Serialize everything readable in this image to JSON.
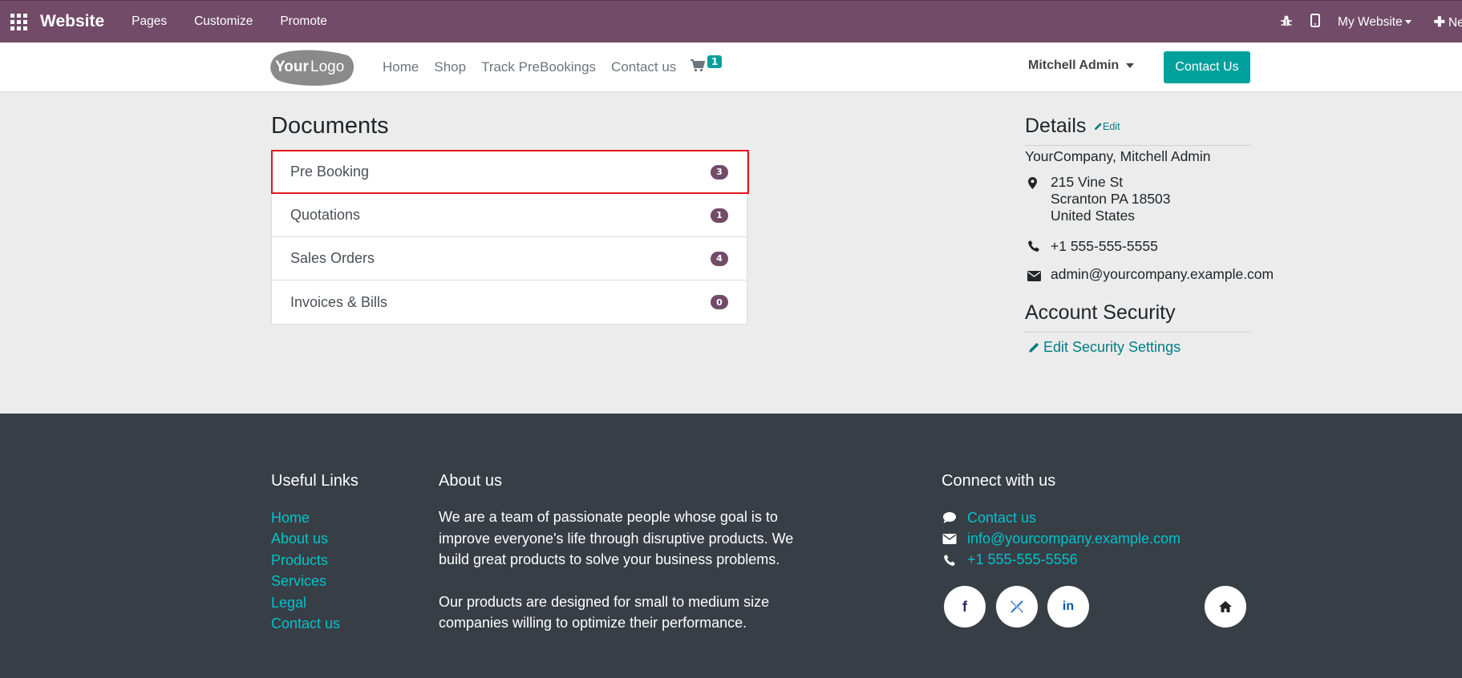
{
  "admin_bar": {
    "brand": "Website",
    "menu": [
      "Pages",
      "Customize",
      "Promote"
    ],
    "website_selector": "My Website",
    "new_label": "New",
    "icons": [
      "apps-icon",
      "bug-icon",
      "mobile-icon",
      "plus-icon"
    ]
  },
  "header": {
    "logo_text": {
      "your": "Your",
      "logo": "Logo"
    },
    "nav": [
      "Home",
      "Shop",
      "Track PreBookings",
      "Contact us"
    ],
    "cart_count": "1",
    "user": "Mitchell Admin",
    "contact_button": "Contact Us"
  },
  "documents": {
    "title": "Documents",
    "items": [
      {
        "label": "Pre Booking",
        "count": "3",
        "highlighted": true
      },
      {
        "label": "Quotations",
        "count": "1"
      },
      {
        "label": "Sales Orders",
        "count": "4"
      },
      {
        "label": "Invoices & Bills",
        "count": "0"
      }
    ]
  },
  "details": {
    "title": "Details",
    "edit": "Edit",
    "company": "YourCompany, Mitchell Admin",
    "address": [
      "215 Vine St",
      "Scranton PA 18503",
      "United States"
    ],
    "phone": "+1 555-555-5555",
    "email": "admin@yourcompany.example.com"
  },
  "security": {
    "title": "Account Security",
    "link": "Edit Security Settings"
  },
  "footer": {
    "useful_links_title": "Useful Links",
    "useful_links": [
      "Home",
      "About us",
      "Products",
      "Services",
      "Legal",
      "Contact us"
    ],
    "about_title": "About us",
    "about_paragraphs": [
      "We are a team of passionate people whose goal is to improve everyone's life through disruptive products. We build great products to solve your business problems.",
      "Our products are designed for small to medium size companies willing to optimize their performance."
    ],
    "connect_title": "Connect with us",
    "connect": [
      {
        "icon": "comment-icon",
        "label": "Contact us"
      },
      {
        "icon": "envelope-icon",
        "label": "info@yourcompany.example.com"
      },
      {
        "icon": "phone-icon",
        "label": "+1 555-555-5556"
      }
    ],
    "social": [
      "facebook-icon",
      "x-icon",
      "linkedin-icon",
      "home-icon"
    ]
  },
  "colors": {
    "admin_bar": "#714b67",
    "primary": "#00a09d",
    "link": "#017e84",
    "footer_bg": "#383e45",
    "footer_link": "#00c3cc",
    "highlight": "#e0161e"
  }
}
